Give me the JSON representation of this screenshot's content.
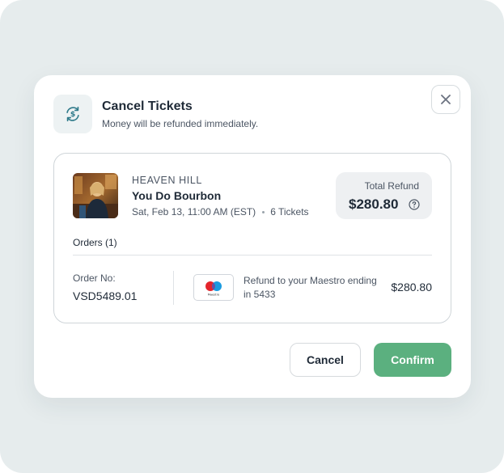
{
  "colors": {
    "backdrop": "#e6eced",
    "accent_green": "#5bb07f",
    "icon_teal": "#2f7a8a",
    "text_primary": "#1f2a37",
    "text_secondary": "#4b5563"
  },
  "header": {
    "icon": "refund-cycle-dollar-icon",
    "title": "Cancel Tickets",
    "subtitle": "Money will be refunded immediately.",
    "close_icon": "close-icon"
  },
  "event": {
    "brand": "HEAVEN HILL",
    "name": "You Do Bourbon",
    "datetime": "Sat, Feb 13, 11:00 AM (EST)",
    "tickets": "6 Tickets"
  },
  "total_refund": {
    "label": "Total Refund",
    "amount": "$280.80",
    "help_icon": "question-circle-icon"
  },
  "orders": {
    "label": "Orders (1)",
    "items": [
      {
        "order_no_label": "Order No:",
        "order_no": "VSD5489.01",
        "card_brand": "maestro",
        "card_logo_text": "Maestro",
        "refund_text": "Refund to your Maestro ending in 5433",
        "amount": "$280.80"
      }
    ]
  },
  "actions": {
    "cancel_label": "Cancel",
    "confirm_label": "Confirm"
  }
}
